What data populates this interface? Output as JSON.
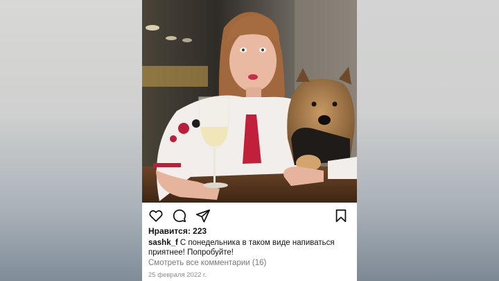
{
  "post": {
    "photo": {
      "depicts": "woman-with-dog-and-wine-glass"
    },
    "actions": {
      "like_icon": "heart-icon",
      "comment_icon": "comment-bubble-icon",
      "share_icon": "paper-plane-icon",
      "save_icon": "bookmark-icon"
    },
    "likes": "Нравится: 223",
    "caption": {
      "username": "sashk_f",
      "text": "С понедельника в таком виде напиваться приятнее! Попробуйте!"
    },
    "view_comments": "Смотреть все комментарии (16)",
    "date": "25 февраля 2022 г."
  }
}
